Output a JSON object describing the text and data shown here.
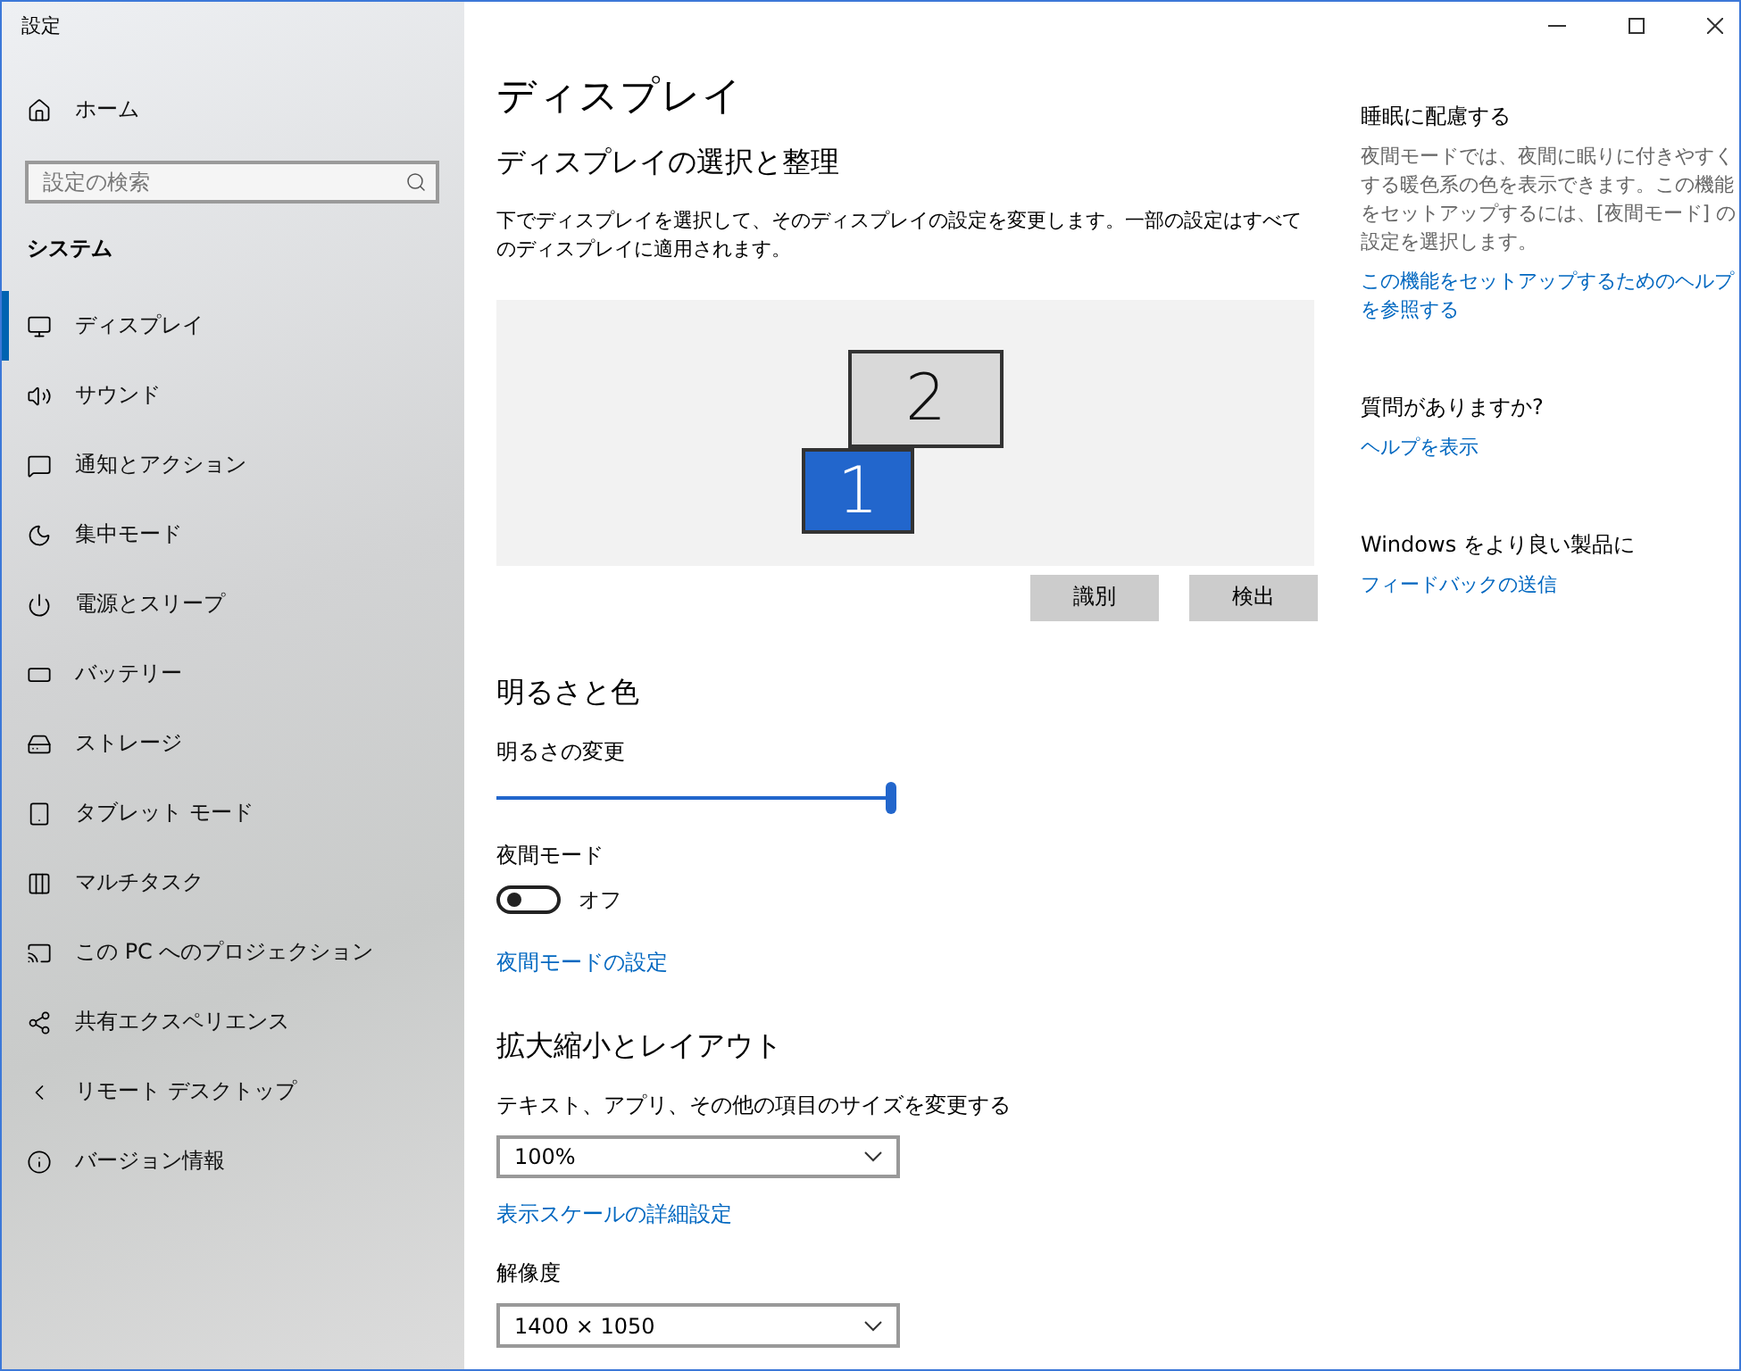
{
  "window": {
    "title": "設定"
  },
  "sidebar": {
    "home": "ホーム",
    "search": {
      "placeholder": "設定の検索"
    },
    "section": "システム",
    "items": [
      {
        "label": "ディスプレイ",
        "selected": true
      },
      {
        "label": "サウンド",
        "selected": false
      },
      {
        "label": "通知とアクション",
        "selected": false
      },
      {
        "label": "集中モード",
        "selected": false
      },
      {
        "label": "電源とスリープ",
        "selected": false
      },
      {
        "label": "バッテリー",
        "selected": false
      },
      {
        "label": "ストレージ",
        "selected": false
      },
      {
        "label": "タブレット モード",
        "selected": false
      },
      {
        "label": "マルチタスク",
        "selected": false
      },
      {
        "label": "この PC へのプロジェクション",
        "selected": false
      },
      {
        "label": "共有エクスペリエンス",
        "selected": false
      },
      {
        "label": "リモート デスクトップ",
        "selected": false
      },
      {
        "label": "バージョン情報",
        "selected": false
      }
    ]
  },
  "main": {
    "title": "ディスプレイ",
    "arrangement": {
      "heading": "ディスプレイの選択と整理",
      "description": "下でディスプレイを選択して、そのディスプレイの設定を変更します。一部の設定はすべてのディスプレイに適用されます。",
      "monitors": [
        {
          "label": "2",
          "selected": false
        },
        {
          "label": "1",
          "selected": true
        }
      ],
      "buttons": [
        "識別",
        "検出"
      ]
    },
    "brightness": {
      "heading": "明るさと色",
      "label": "明るさの変更",
      "level": 1
    },
    "night_mode": {
      "label": "夜間モード",
      "on": false,
      "state_text": "オフ",
      "link": "夜間モードの設定"
    },
    "scale": {
      "heading": "拡大縮小とレイアウト",
      "label": "テキスト、アプリ、その他の項目のサイズを変更する",
      "value": "100%",
      "link": "表示スケールの詳細設定",
      "resolution_label": "解像度",
      "resolution_value": "1400 × 1050"
    }
  },
  "aside": [
    {
      "heading": "睡眠に配慮する",
      "text": "夜間モードでは、夜間に眠りに付きやすくする暖色系の色を表示できます。この機能をセットアップするには、[夜間モード] の設定を選択します。",
      "link": "この機能をセットアップするためのヘルプを参照する"
    },
    {
      "heading": "質問がありますか?",
      "link": "ヘルプを表示"
    },
    {
      "heading": "Windows をより良い製品に",
      "link": "フィードバックの送信"
    }
  ]
}
